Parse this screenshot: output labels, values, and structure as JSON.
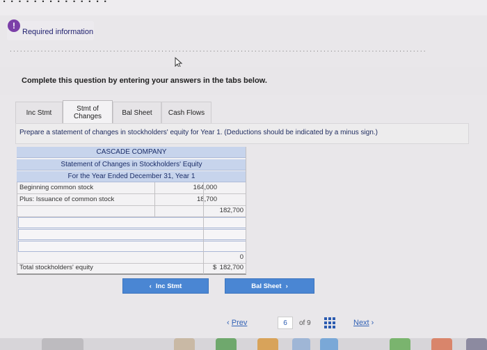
{
  "requirement": {
    "label": "Required information"
  },
  "instruction": "Complete this question by entering your answers in the tabs below.",
  "tabs": [
    {
      "label": "Inc Stmt"
    },
    {
      "label_line1": "Stmt of",
      "label_line2": "Changes"
    },
    {
      "label": "Bal Sheet"
    },
    {
      "label": "Cash Flows"
    }
  ],
  "prompt": "Prepare a statement of changes in stockholders' equity for Year 1. (Deductions should be indicated by a minus sign.)",
  "statement": {
    "company": "CASCADE COMPANY",
    "title": "Statement of Changes in Stockholders' Equity",
    "period": "For the Year Ended December 31, Year 1",
    "rows": [
      {
        "label": "Beginning common stock",
        "col1": "164,000",
        "col2": ""
      },
      {
        "label": "Plus: Issuance of common stock",
        "col1": "18,700",
        "col2": ""
      }
    ],
    "subtotal": "182,700",
    "re_value": "0",
    "total_label": "Total stockholders' equity",
    "total_currency": "$",
    "total_value": "182,700"
  },
  "nav": {
    "prev_button": "Inc Stmt",
    "next_button": "Bal Sheet",
    "prev_link": "Prev",
    "page_current": "6",
    "page_of": "of 9",
    "next_link": "Next"
  },
  "colors": {
    "accent": "#4a86d3",
    "header_band": "#c7d4ec"
  }
}
